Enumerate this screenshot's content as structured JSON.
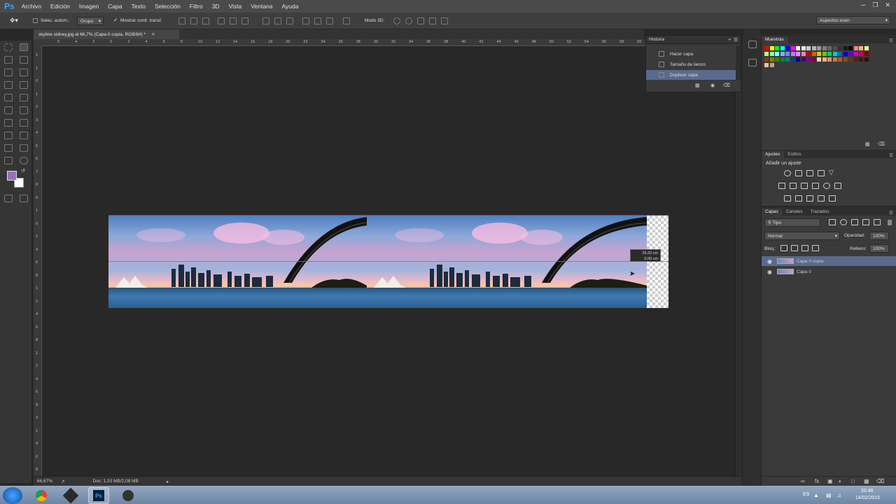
{
  "app": {
    "logo": "Ps"
  },
  "menu": [
    "Archivo",
    "Edición",
    "Imagen",
    "Capa",
    "Texto",
    "Selección",
    "Filtro",
    "3D",
    "Vista",
    "Ventana",
    "Ayuda"
  ],
  "options": {
    "auto_select_label": "Selec. autom.:",
    "auto_select_value": "Grupo",
    "show_transform_label": "Mostrar contr. transf.",
    "mode3d_label": "Modo 3D:",
    "workspace": "Aspectos esen."
  },
  "document": {
    "tab_title": "skyline sidney.jpg al 66,7% (Capa 0 copia, RGB/8#) *"
  },
  "ruler": {
    "top": [
      "6",
      "4",
      "2",
      "0",
      "2",
      "4",
      "6",
      "8",
      "10",
      "12",
      "14",
      "16",
      "18",
      "20",
      "22",
      "24",
      "26",
      "28",
      "30",
      "32",
      "34",
      "36",
      "38",
      "40",
      "42",
      "44",
      "46",
      "48",
      "50",
      "52",
      "54",
      "56",
      "58",
      "60"
    ],
    "left": [
      "2",
      "1",
      "0",
      "1",
      "2",
      "3",
      "4",
      "5",
      "6",
      "7",
      "8",
      "9",
      "1",
      "0",
      "2",
      "4",
      "6",
      "8",
      "1",
      "2",
      "4",
      "6",
      "8",
      "1",
      "2",
      "4",
      "6",
      "8",
      "3",
      "2",
      "4",
      "6",
      "8"
    ]
  },
  "history": {
    "title": "Historia",
    "items": [
      "Hacer capa",
      "Tamaño de lienzo",
      "Duplicar capa"
    ],
    "selected": 2
  },
  "swatches": {
    "title": "Muestras",
    "colors": [
      "#ff0000",
      "#ffff00",
      "#00ff00",
      "#00ffff",
      "#0000ff",
      "#ff00ff",
      "#ffffff",
      "#e6e6e6",
      "#cccccc",
      "#b3b3b3",
      "#999999",
      "#808080",
      "#666666",
      "#4d4d4d",
      "#333333",
      "#1a1a1a",
      "#000000",
      "#ff8080",
      "#ffb380",
      "#ffff80",
      "#b3ff80",
      "#80ffb3",
      "#80ffff",
      "#80b3ff",
      "#8080ff",
      "#b380ff",
      "#ff80ff",
      "#ff80b3",
      "#cc0000",
      "#cc6600",
      "#cccc00",
      "#66cc00",
      "#00cc66",
      "#00cccc",
      "#0066cc",
      "#0000cc",
      "#6600cc",
      "#cc00cc",
      "#cc0066",
      "#800000",
      "#804000",
      "#808000",
      "#408000",
      "#008040",
      "#008080",
      "#004080",
      "#000080",
      "#400080",
      "#800080",
      "#800040",
      "#f2d9c4",
      "#e6b894",
      "#d9966b",
      "#c47a4d",
      "#a35e33",
      "#8c4a24",
      "#6b3518",
      "#52260f",
      "#3d1a08",
      "#2b1105",
      "#e0c4a8",
      "#c8a07a"
    ]
  },
  "adjustments": {
    "tabs": [
      "Ajustes",
      "Estilos"
    ],
    "title": "Añadir un ajuste"
  },
  "layers_panel": {
    "tabs": [
      "Capas",
      "Canales",
      "Trazados"
    ],
    "filter": "Tipo",
    "blend_mode": "Normal",
    "opacity_label": "Opacidad:",
    "opacity": "100%",
    "lock_label": "Bloq.:",
    "fill_label": "Relleno:",
    "fill": "100%",
    "layers": [
      {
        "name": "Capa 0 copia",
        "selected": true
      },
      {
        "name": "Capa 0",
        "selected": false
      }
    ]
  },
  "tooltip": {
    "line1": "29,32 cm",
    "line2": "0,00 cm"
  },
  "status": {
    "zoom": "66,67%",
    "doc": "Doc: 1,53 MB/2,08 MB"
  },
  "taskbar": {
    "lang": "ES",
    "time": "20:48",
    "date": "14/02/2015"
  },
  "colors": {
    "foreground": "#9a6fb8",
    "background": "#ffffff",
    "selection_highlight": "#5a6a8c"
  }
}
